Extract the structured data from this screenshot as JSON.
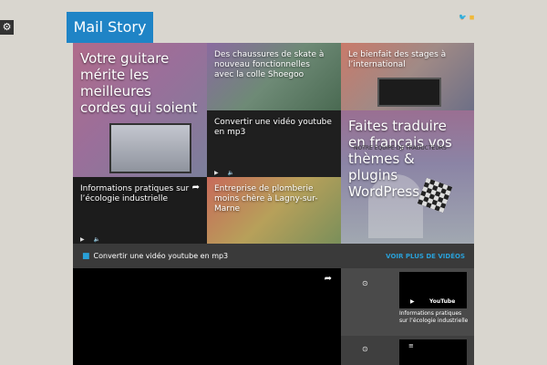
{
  "site": {
    "logo": "Mail Story",
    "gear_icon": "gear-icon",
    "social_icons": [
      "twitter-icon",
      "rss-icon"
    ]
  },
  "tiles": [
    {
      "title": "Votre guitare mérite les meilleures cordes qui soient"
    },
    {
      "title": "Des chaussures de skate à nouveau fonctionnelles avec la colle Shoegoo"
    },
    {
      "title": "Le bienfait des stages à l’international"
    },
    {
      "title": "Convertir une vidéo youtube en mp3"
    },
    {
      "title": "Faites traduire en français vos thèmes & plugins WordPress",
      "overlay_text": "NOTRE ÉQUIPE DE TRADUCTEURS"
    },
    {
      "title": "Informations pratiques sur l’écologie industrielle"
    },
    {
      "title": "Entreprise de plomberie moins chère à Lagny-sur-Marne"
    }
  ],
  "video_section": {
    "current_title": "Convertir une vidéo youtube en mp3",
    "more_link": "VOIR PLUS DE VIDÉOS",
    "playlist": [
      {
        "title": "Informations pratiques sur l’écologie industrielle",
        "logo": "YouTube"
      },
      {
        "title": ""
      }
    ]
  },
  "colors": {
    "logo_bg": "#1f84c6",
    "accent": "#29a0d8",
    "page_bg": "#d9d6cf",
    "bar_bg": "#3a3a3a"
  }
}
